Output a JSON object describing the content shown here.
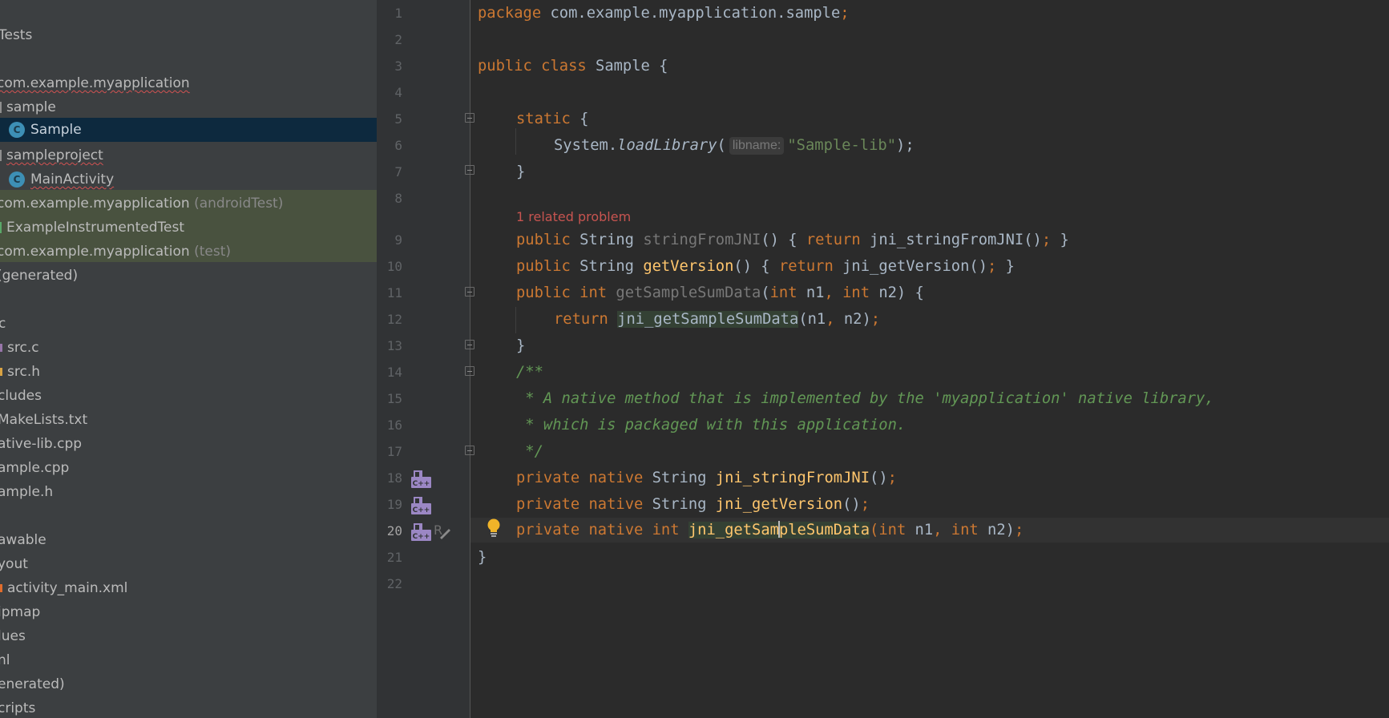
{
  "sidebar": {
    "items": [
      {
        "label": "Tests",
        "style": "plain"
      },
      {
        "label": "com.example.myapplication",
        "style": "squiggle"
      },
      {
        "label": "sample",
        "style": "folder"
      },
      {
        "label": "Sample",
        "style": "class",
        "selected": true
      },
      {
        "label": "sampleproject",
        "style": "folder-squiggle"
      },
      {
        "label": "MainActivity",
        "style": "class-squiggle"
      },
      {
        "label": "com.example.myapplication",
        "suffix": "(androidTest)",
        "style": "test"
      },
      {
        "label": "ExampleInstrumentedTest",
        "style": "test-class"
      },
      {
        "label": "com.example.myapplication",
        "suffix": "(test)",
        "style": "test"
      },
      {
        "label": "(generated)",
        "style": "dim"
      },
      {
        "label": "c",
        "style": "plain"
      },
      {
        "label": "src.c",
        "style": "cfile"
      },
      {
        "label": "src.h",
        "style": "hfile"
      },
      {
        "label": "cludes",
        "style": "plain"
      },
      {
        "label": "MakeLists.txt",
        "style": "plain"
      },
      {
        "label": "ative-lib.cpp",
        "style": "plain"
      },
      {
        "label": "ample.cpp",
        "style": "plain"
      },
      {
        "label": "ample.h",
        "style": "plain"
      },
      {
        "label": "awable",
        "style": "plain"
      },
      {
        "label": "yout",
        "style": "plain"
      },
      {
        "label": "activity_main.xml",
        "style": "xml"
      },
      {
        "label": "ipmap",
        "style": "plain"
      },
      {
        "label": "lues",
        "style": "plain"
      },
      {
        "label": "nl",
        "style": "plain"
      },
      {
        "label": "enerated)",
        "style": "dim"
      },
      {
        "label": "cripts",
        "style": "plain"
      }
    ]
  },
  "editor": {
    "current_line": 20,
    "line_numbers": [
      "1",
      "2",
      "3",
      "4",
      "5",
      "6",
      "7",
      "8",
      "9",
      "10",
      "11",
      "12",
      "13",
      "14",
      "15",
      "16",
      "17",
      "18",
      "19",
      "20",
      "21",
      "22"
    ],
    "problem_hint": "1 related problem",
    "param_hint": "libname:",
    "lines": {
      "l1": {
        "kw": "package",
        "rest": " com.example.myapplication.sample",
        "semi": ";"
      },
      "l3": {
        "kw1": "public",
        "kw2": "class",
        "rest": " Sample {"
      },
      "l5": {
        "kw": "static",
        "rest": " {"
      },
      "l6": {
        "a": "System.",
        "b": "loadLibrary",
        "c": "(",
        "str": "\"Sample-lib\"",
        "d": ");"
      },
      "l7": {
        "a": "}"
      },
      "l9": {
        "kw": "public",
        "t": " String ",
        "name": "stringFromJNI",
        "b": "() { ",
        "ret": "return",
        "c": " jni_stringFromJNI()",
        "semi": ";",
        "d": " }"
      },
      "l10": {
        "kw": "public",
        "t": " String ",
        "name": "getVersion",
        "b": "() { ",
        "ret": "return",
        "c": " jni_getVersion()",
        "semi": ";",
        "d": " }"
      },
      "l11": {
        "kw": "public",
        "ty": "int",
        "name": "getSampleSumData",
        "b": "(",
        "kw2": "int",
        "c": " n1",
        "comma": ",",
        "kw3": "int",
        "d": " n2) {"
      },
      "l12": {
        "ret": "return",
        "call": "jni_getSampleSumData",
        "b": "(n1",
        "comma": ",",
        "c": " n2)",
        "semi": ";"
      },
      "l13": {
        "a": "}"
      },
      "l14": {
        "a": "/**"
      },
      "l15": {
        "a": " * A native method that is implemented by the 'myapplication' native library,"
      },
      "l16": {
        "a": " * which is packaged with this application."
      },
      "l17": {
        "a": " */"
      },
      "l18": {
        "kw1": "private",
        "kw2": "native",
        "t": " String ",
        "name": "jni_stringFromJNI",
        "b": "()",
        "semi": ";"
      },
      "l19": {
        "kw1": "private",
        "kw2": "native",
        "t": " String ",
        "name": "jni_getVersion",
        "b": "()",
        "semi": ";"
      },
      "l20": {
        "kw1": "private",
        "kw2": "native",
        "kw3": "int",
        "name_a": "jni_getSam",
        "name_b": "pleSumData",
        "b": "(",
        "kw4": "int",
        "c": " n1",
        "comma": ",",
        "kw5": "int",
        "d": " n2)",
        "semi": ";"
      },
      "l21": {
        "a": "}"
      }
    }
  }
}
